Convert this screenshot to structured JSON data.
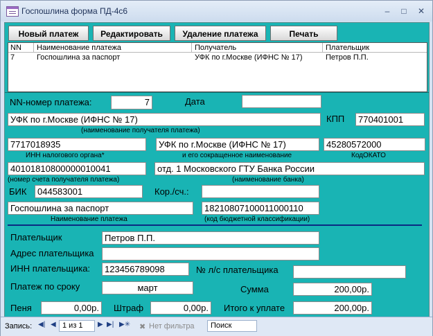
{
  "window": {
    "title": "Госпошлина форма ПД-4с6",
    "minimize_glyph": "–",
    "maximize_glyph": "□",
    "close_glyph": "✕"
  },
  "toolbar": {
    "new_label": "Новый платеж",
    "edit_label": "Редактировать",
    "delete_label": "Удаление платежа",
    "print_label": "Печать"
  },
  "list": {
    "headers": [
      "NN",
      "Наименование платежа",
      "Получатель",
      "Плательщик"
    ],
    "rows": [
      [
        "7",
        "Госпошлина за паспорт",
        "УФК по г.Москве (ИФНС № 17)",
        "Петров П.П."
      ]
    ]
  },
  "form": {
    "nn_label": "NN-номер платежа:",
    "nn_value": "7",
    "date_label": "Дата",
    "date_value": "",
    "recipient_value": "УФК по г.Москве (ИФНС № 17)",
    "recipient_caption": "(наименование получателя платежа)",
    "kpp_label": "КПП",
    "kpp_value": "770401001",
    "inn_value": "7717018935",
    "inn_caption": "ИНН налогового органа*",
    "short_name_value": "УФК по г.Москве (ИФНС № 17)",
    "short_name_caption": "и его сокращенное наименование",
    "okato_value": "45280572000",
    "okato_caption": "КодОКАТО",
    "account_value": "40101810800000010041",
    "account_caption": "(номер счета получателя платежа)",
    "bank_value": "отд. 1 Московского ГТУ Банка России",
    "bank_caption": "(наименование банка)",
    "bik_label": "БИК",
    "bik_value": "044583001",
    "corr_label": "Кор./сч.:",
    "corr_value": "",
    "payment_name_value": "Госпошлина за паспорт",
    "payment_name_caption": "Наименование платежа",
    "kbk_value": "18210807100011000110",
    "kbk_caption": "(код бюджетной классификации)",
    "payer_label": "Плательщик",
    "payer_value": "Петров П.П.",
    "address_label": "Адрес плательщика",
    "address_value": "",
    "payer_inn_label": "ИНН плательщика:",
    "payer_inn_value": "123456789098",
    "account_no_label": "№ л/с плательщика",
    "account_no_value": "",
    "term_label": "Платеж по сроку",
    "term_value": "март",
    "sum_label": "Сумма",
    "sum_value": "200,00р.",
    "penalty_label": "Пеня",
    "penalty_value": "0,00р.",
    "fine_label": "Штраф",
    "fine_value": "0,00р.",
    "total_label": "Итого к уплате",
    "total_value": "200,00р."
  },
  "navigation": {
    "record_label": "Запись:",
    "record_position": "1 из 1",
    "filter_label": "Нет фильтра",
    "search_label": "Поиск"
  },
  "colors": {
    "form_background": "#19b4b4",
    "divider": "#0b2a82"
  }
}
